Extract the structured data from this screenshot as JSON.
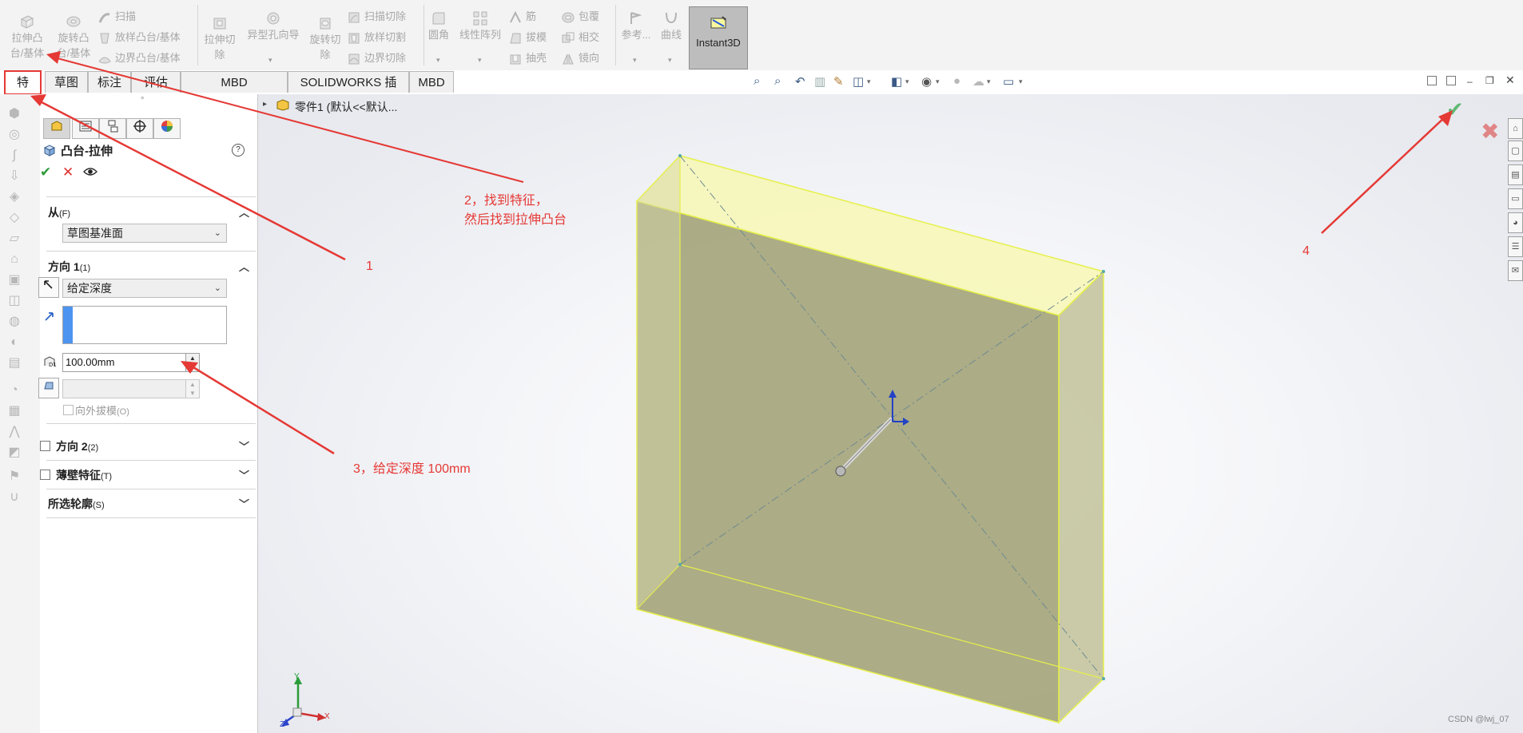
{
  "ribbon": {
    "boss_extrude": [
      "拉伸凸",
      "台/基体"
    ],
    "revolve_boss": [
      "旋转凸",
      "台/基体"
    ],
    "sweep": "扫描",
    "loft_boss": "放样凸台/基体",
    "boundary_boss": "边界凸台/基体",
    "extruded_cut": [
      "拉伸切",
      "除"
    ],
    "hole_wizard": "异型孔向导",
    "revolved_cut": [
      "旋转切",
      "除"
    ],
    "swept_cut": "扫描切除",
    "lofted_cut": "放样切割",
    "boundary_cut": "边界切除",
    "fillet": "圆角",
    "linear_pattern": "线性阵列",
    "rib": "筋",
    "draft": "拔模",
    "shell": "抽壳",
    "wrap": "包覆",
    "intersect": "相交",
    "mirror": "镜向",
    "reference": "参考...",
    "curves": "曲线",
    "instant3d": "Instant3D"
  },
  "tabs": [
    "特征",
    "草图",
    "标注",
    "评估",
    "MBD Dimensions",
    "SOLIDWORKS 插件",
    "MBD"
  ],
  "tree": {
    "part": "零件1  (默认<<默认..."
  },
  "pm": {
    "title": "凸台-拉伸",
    "help": "?",
    "from_label": "从",
    "from_key": "(F)",
    "from_value": "草图基准面",
    "dir1_label": "方向 1",
    "dir1_key": "(1)",
    "end_condition": "给定深度",
    "depth": "100.00mm",
    "draft_outward": "向外拔模",
    "draft_key": "(O)",
    "dir2_label": "方向 2",
    "dir2_key": "(2)",
    "thin_label": "薄壁特征",
    "thin_key": "(T)",
    "contours_label": "所选轮廓",
    "contours_key": "(S)"
  },
  "annotations": {
    "a1": "1",
    "a2_line1": "2，找到特征，",
    "a2_line2": "然后找到拉伸凸台",
    "a3": "3，给定深度 100mm",
    "a4": "4"
  },
  "triad": {
    "x": "X",
    "y": "Y",
    "z": "Z"
  },
  "watermark": "CSDN @lwj_07",
  "colors": {
    "annotation": "#e53935",
    "box_fill": "#a5a57c",
    "box_edge": "#e6f04a",
    "ok_green": "#35a84a",
    "cancel_red": "#d44"
  }
}
